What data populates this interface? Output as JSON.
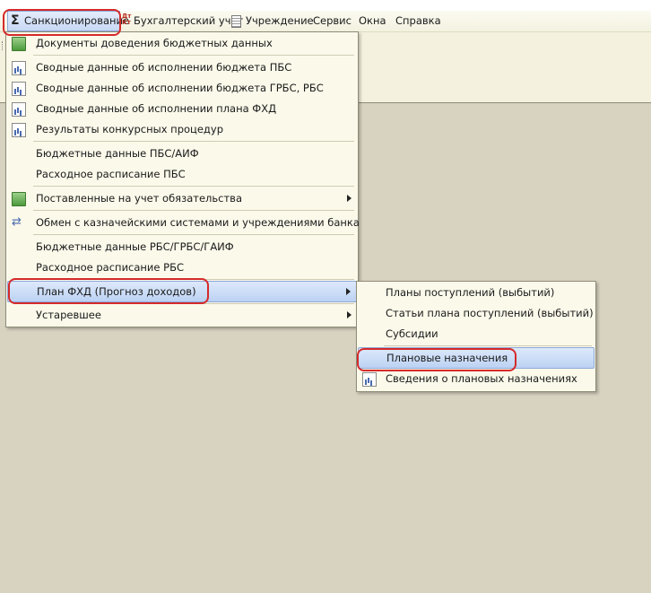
{
  "menubar": {
    "items": [
      {
        "label": "Санкционирование",
        "icon": "sigma-icon"
      },
      {
        "label": "Бухгалтерский учет",
        "icon": "debit-credit-icon"
      },
      {
        "label": "Учреждение",
        "icon": "document-icon"
      },
      {
        "label": "Сервис"
      },
      {
        "label": "Окна"
      },
      {
        "label": "Справка"
      }
    ]
  },
  "menu": {
    "items": [
      {
        "label": "Документы доведения бюджетных данных",
        "icon": "spreadsheet-icon"
      },
      {
        "label": "Сводные данные об исполнении бюджета ПБС",
        "icon": "report-icon"
      },
      {
        "label": "Сводные данные об исполнении бюджета ГРБС, РБС",
        "icon": "report-icon"
      },
      {
        "label": "Сводные данные об исполнении плана ФХД",
        "icon": "report-icon"
      },
      {
        "label": "Результаты конкурсных процедур",
        "icon": "report-icon"
      },
      {
        "label": "Бюджетные данные ПБС/АИФ"
      },
      {
        "label": "Расходное расписание ПБС"
      },
      {
        "label": "Поставленные на учет обязательства",
        "icon": "spreadsheet-icon",
        "submenu": true
      },
      {
        "label": "Обмен с казначейскими системами и учреждениями банка",
        "icon": "exchange-icon"
      },
      {
        "label": "Бюджетные данные РБС/ГРБС/ГАИФ"
      },
      {
        "label": "Расходное расписание РБС"
      },
      {
        "label": "План ФХД (Прогноз доходов)",
        "submenu": true,
        "highlighted": true
      },
      {
        "label": "Устаревшее",
        "submenu": true
      }
    ]
  },
  "submenu": {
    "items": [
      {
        "label": "Планы поступлений (выбытий)"
      },
      {
        "label": "Статьи плана поступлений (выбытий)"
      },
      {
        "label": "Субсидии"
      },
      {
        "label": "Плановые назначения",
        "highlighted": true
      },
      {
        "label": "Сведения о плановых назначениях",
        "icon": "report-icon"
      }
    ]
  },
  "colors": {
    "annotation": "#d42a2a",
    "highlight": "#bcd2f3",
    "menu_bg": "#fbf9ea",
    "desktop_bg": "#d8d3c0"
  }
}
